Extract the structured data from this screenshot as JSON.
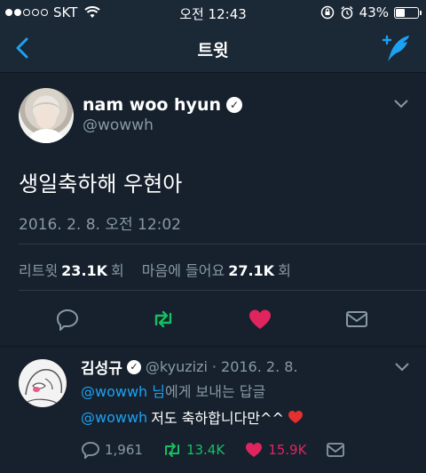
{
  "status_bar": {
    "carrier": "SKT",
    "time": "오전 12:43",
    "battery_percent": "43%",
    "battery_level": 0.43,
    "signal_bars": 2
  },
  "nav": {
    "title": "트윗",
    "back_icon": "chevron-left-icon",
    "compose_icon": "compose-tweet-icon"
  },
  "tweet": {
    "author_name": "nam woo hyun",
    "author_handle": "@wowwh",
    "text": "생일축하해 우현아",
    "timestamp": "2016. 2. 8. 오전 12:02",
    "retweet_label": "리트윗",
    "retweet_count": "23.1K",
    "count_suffix": "회",
    "like_label": "마음에 들어요",
    "like_count": "27.1K",
    "liked": true,
    "retweeted": true
  },
  "reply": {
    "author_name": "김성규",
    "author_handle": "@kyuzizi",
    "date": "2016. 2. 8.",
    "reply_to_handle": "@wowwh",
    "reply_to_name_suffix": "님",
    "reply_to_text": "에게 보내는 답글",
    "mention": "@wowwh",
    "text": "저도 축하합니다만^^",
    "reply_count": "1,961",
    "retweet_count": "13.4K",
    "like_count": "15.9K"
  },
  "colors": {
    "background": "#16212d",
    "bar": "#1b2836",
    "accent_blue": "#1da1f2",
    "retweet_green": "#17bf63",
    "like_red": "#e0245e",
    "muted": "#8899a6"
  }
}
